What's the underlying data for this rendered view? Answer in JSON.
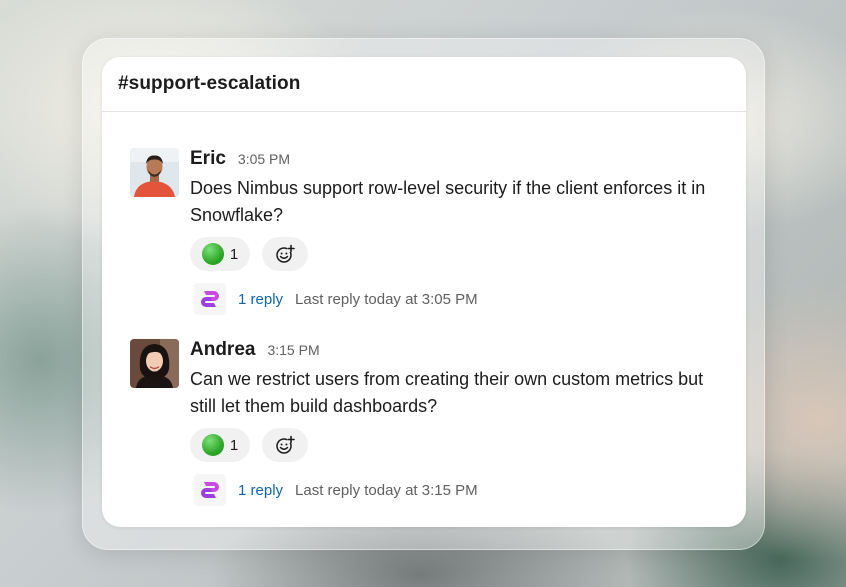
{
  "channel": {
    "name": "#support-escalation"
  },
  "messages": [
    {
      "author": "Eric",
      "time": "3:05 PM",
      "text": "Does Nimbus support row-level security if the client enforces it in Snowflake?",
      "reaction_count": "1",
      "reply_label": "1 reply",
      "last_reply": "Last reply today at 3:05 PM"
    },
    {
      "author": "Andrea",
      "time": "3:15 PM",
      "text": "Can we restrict users from creating their own custom metrics but still let them build dashboards?",
      "reaction_count": "1",
      "reply_label": "1 reply",
      "last_reply": "Last reply today at 3:15 PM"
    }
  ],
  "colors": {
    "link": "#1264a3",
    "reaction_green": "#2fa82a",
    "thread_logo": "#c84be0"
  },
  "icons": {
    "reaction_emoji": "green-circle-icon",
    "add_reaction": "add-emoji-icon",
    "thread_avatar": "app-logo-icon"
  }
}
